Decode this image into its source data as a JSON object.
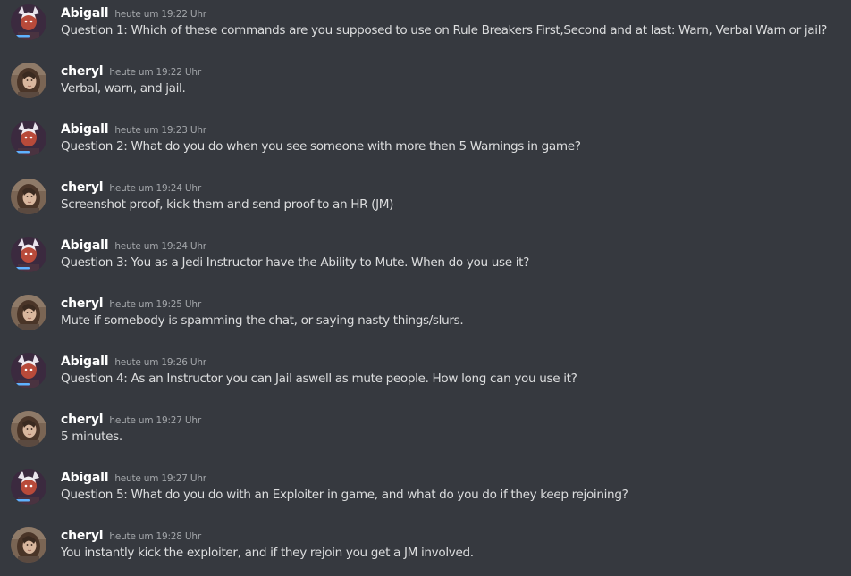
{
  "messages": [
    {
      "author": "Abigall",
      "avatar": "abigall-avatar",
      "timestamp": "heute um 19:22 Uhr",
      "text": "Question 1: Which of these commands are you supposed to use on Rule Breakers First,Second and at last: Warn, Verbal Warn or jail?"
    },
    {
      "author": "cheryl",
      "avatar": "cheryl-avatar",
      "timestamp": "heute um 19:22 Uhr",
      "text": "Verbal, warn, and jail."
    },
    {
      "author": "Abigall",
      "avatar": "abigall-avatar",
      "timestamp": "heute um 19:23 Uhr",
      "text": "Question 2: What do you do when you see someone with more then 5 Warnings in game?"
    },
    {
      "author": "cheryl",
      "avatar": "cheryl-avatar",
      "timestamp": "heute um 19:24 Uhr",
      "text": "Screenshot proof, kick them and send proof to an HR (JM)"
    },
    {
      "author": "Abigall",
      "avatar": "abigall-avatar",
      "timestamp": "heute um 19:24 Uhr",
      "text": "Question 3: You as a Jedi Instructor have the Ability to Mute. When do you use it?"
    },
    {
      "author": "cheryl",
      "avatar": "cheryl-avatar",
      "timestamp": "heute um 19:25 Uhr",
      "text": "Mute if somebody is spamming the chat, or saying nasty things/slurs."
    },
    {
      "author": "Abigall",
      "avatar": "abigall-avatar",
      "timestamp": "heute um 19:26 Uhr",
      "text": "Question 4: As an Instructor you can Jail aswell as mute people. How long can you use it?"
    },
    {
      "author": "cheryl",
      "avatar": "cheryl-avatar",
      "timestamp": "heute um 19:27 Uhr",
      "text": "5 minutes."
    },
    {
      "author": "Abigall",
      "avatar": "abigall-avatar",
      "timestamp": "heute um 19:27 Uhr",
      "text": "Question 5: What do you do with an Exploiter in game, and what do you do if they keep rejoining?"
    },
    {
      "author": "cheryl",
      "avatar": "cheryl-avatar",
      "timestamp": "heute um 19:28 Uhr",
      "text": "You instantly kick the exploiter, and if they rejoin you get a JM involved."
    }
  ]
}
